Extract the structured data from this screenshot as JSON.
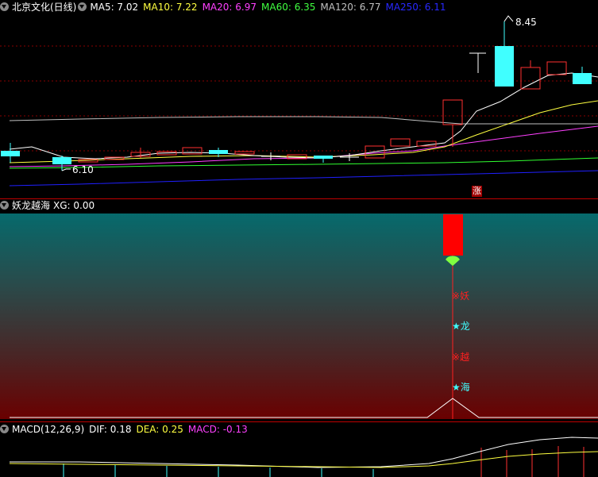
{
  "price_panel": {
    "title": "北京文化(日线)",
    "ma_labels": [
      {
        "text": "MA5: 7.02",
        "color": "#ffffff"
      },
      {
        "text": "MA10: 7.22",
        "color": "#ffff40"
      },
      {
        "text": "MA20: 6.97",
        "color": "#ff40ff"
      },
      {
        "text": "MA60: 6.35",
        "color": "#40ff40"
      },
      {
        "text": "MA120: 6.77",
        "color": "#c0c0c0"
      },
      {
        "text": "MA250: 6.11",
        "color": "#4040ff"
      }
    ],
    "high_label": "8.45",
    "low_label": "6.10",
    "limit_badge": "涨"
  },
  "indicator_panel": {
    "title": "妖龙越海",
    "xg_label": "XG: 0.00",
    "signals": [
      {
        "symbol": "※",
        "char": "妖",
        "color": "#ff2020"
      },
      {
        "symbol": "★",
        "char": "龙",
        "color": "#40ffff"
      },
      {
        "symbol": "※",
        "char": "越",
        "color": "#ff2020"
      },
      {
        "symbol": "★",
        "char": "海",
        "color": "#40ffff"
      }
    ]
  },
  "macd_panel": {
    "title": "MACD(12,26,9)",
    "dif_label": "DIF: 0.18",
    "dea_label": "DEA: 0.25",
    "macd_label": "MACD: -0.13"
  },
  "colors": {
    "up": "#ff3030",
    "down": "#40ffff",
    "grid": "#c00000"
  }
}
